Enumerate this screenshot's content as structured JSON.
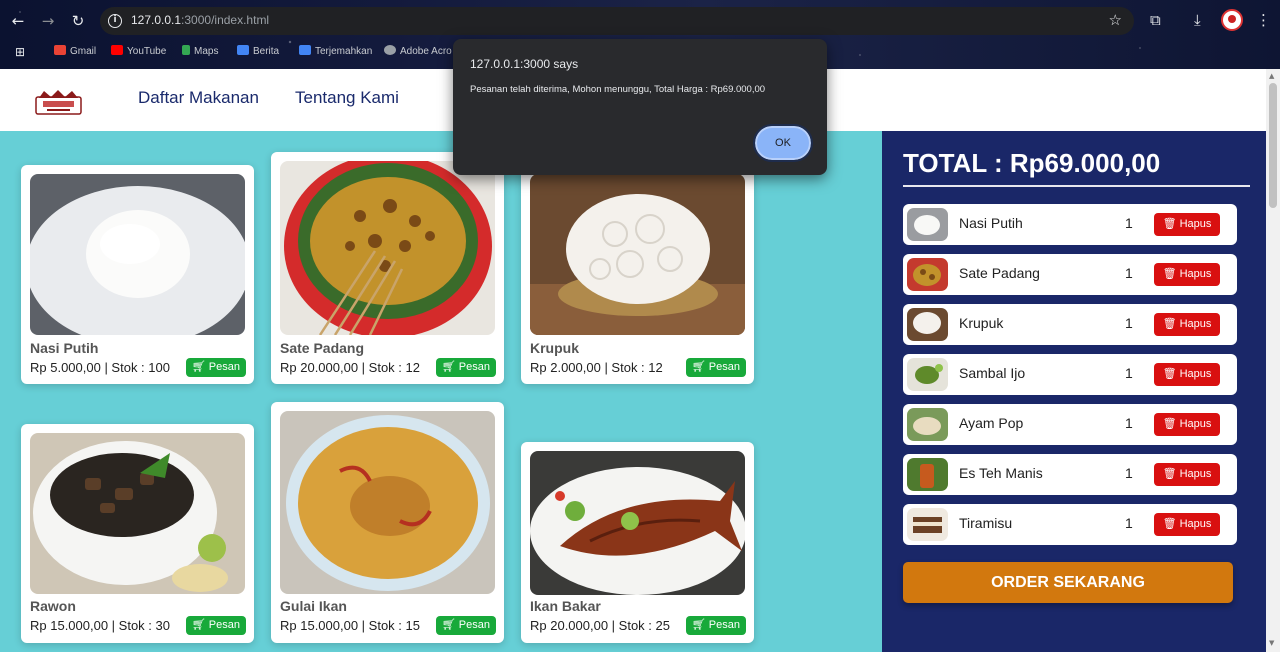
{
  "browser": {
    "url_host": "127.0.0.1",
    "url_path": ":3000/index.html",
    "bookmarks": [
      "Gmail",
      "YouTube",
      "Maps",
      "Berita",
      "Terjemahkan",
      "Adobe Acro"
    ]
  },
  "header": {
    "menu": [
      "Daftar Makanan",
      "Tentang Kami"
    ]
  },
  "products": [
    {
      "name": "Nasi Putih",
      "price": "Rp 5.000,00 | Stok : 100",
      "button": "Pesan"
    },
    {
      "name": "Sate Padang",
      "price": "Rp 20.000,00 | Stok : 12",
      "button": "Pesan"
    },
    {
      "name": "Krupuk",
      "price": "Rp 2.000,00 | Stok : 12",
      "button": "Pesan"
    },
    {
      "name": "Rawon",
      "price": "Rp 15.000,00 | Stok : 30",
      "button": "Pesan"
    },
    {
      "name": "Gulai Ikan",
      "price": "Rp 15.000,00 | Stok : 15",
      "button": "Pesan"
    },
    {
      "name": "Ikan Bakar",
      "price": "Rp 20.000,00 | Stok : 25",
      "button": "Pesan"
    }
  ],
  "cart": {
    "total": "TOTAL : Rp69.000,00",
    "items": [
      {
        "name": "Nasi Putih",
        "qty": "1",
        "button": "Hapus"
      },
      {
        "name": "Sate Padang",
        "qty": "1",
        "button": "Hapus"
      },
      {
        "name": "Krupuk",
        "qty": "1",
        "button": "Hapus"
      },
      {
        "name": "Sambal Ijo",
        "qty": "1",
        "button": "Hapus"
      },
      {
        "name": "Ayam Pop",
        "qty": "1",
        "button": "Hapus"
      },
      {
        "name": "Es Teh Manis",
        "qty": "1",
        "button": "Hapus"
      },
      {
        "name": "Tiramisu",
        "qty": "1",
        "button": "Hapus"
      }
    ],
    "order_button": "ORDER SEKARANG"
  },
  "dialog": {
    "title": "127.0.0.1:3000 says",
    "message": "Pesanan telah diterima, Mohon menunggu, Total Harga : Rp69.000,00",
    "ok": "OK"
  }
}
